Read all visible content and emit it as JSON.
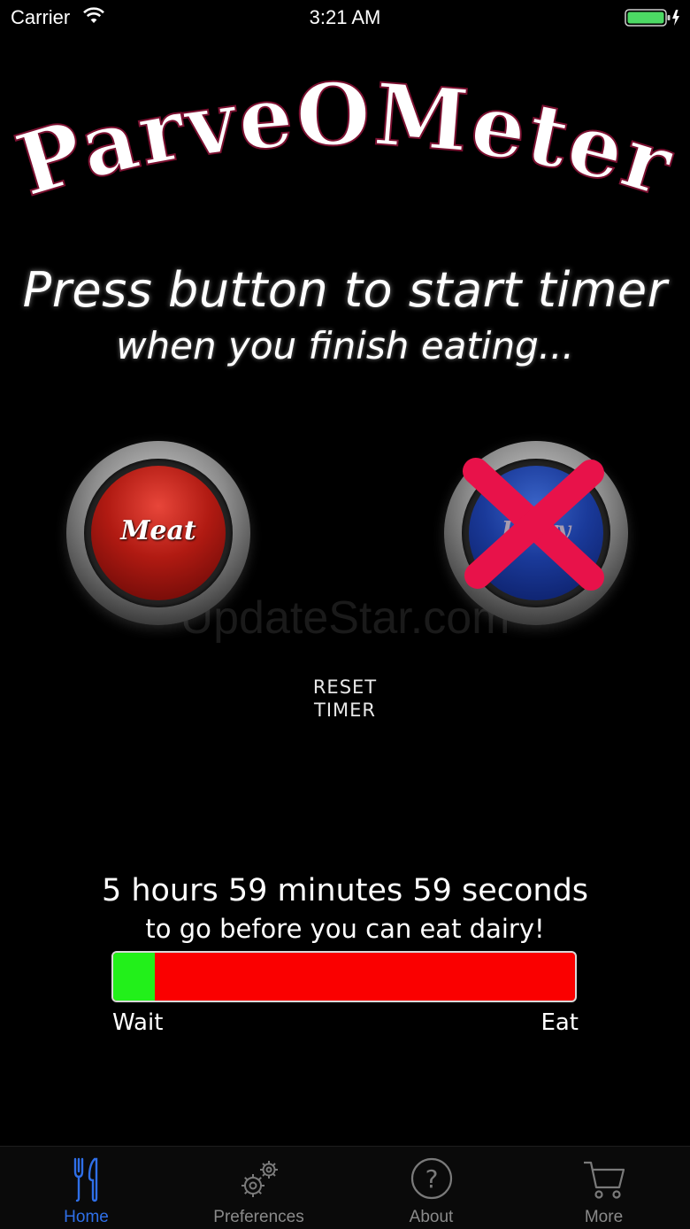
{
  "status_bar": {
    "carrier": "Carrier",
    "time": "3:21 AM"
  },
  "app_title": "ParveOMeter",
  "instructions": {
    "main": "Press button to start timer",
    "sub": "when you finish eating..."
  },
  "buttons": {
    "meat_label": "Meat",
    "dairy_label": "Dairy",
    "dairy_disabled": true,
    "reset_label_line1": "RESET",
    "reset_label_line2": "TIMER"
  },
  "watermark": "UpdateStar.com",
  "countdown": {
    "time_remaining": "5 hours 59 minutes 59 seconds",
    "message": "to go before you can eat dairy!",
    "progress_fraction": 0.09,
    "label_start": "Wait",
    "label_end": "Eat",
    "colors": {
      "elapsed": "#22f01a",
      "remaining": "#fa0000"
    }
  },
  "tab_bar": {
    "tabs": [
      {
        "label": "Home",
        "icon": "fork-knife-icon",
        "active": true
      },
      {
        "label": "Preferences",
        "icon": "gears-icon",
        "active": false
      },
      {
        "label": "About",
        "icon": "question-circle-icon",
        "active": false
      },
      {
        "label": "More",
        "icon": "cart-icon",
        "active": false
      }
    ],
    "active_color": "#2f6fe8"
  }
}
